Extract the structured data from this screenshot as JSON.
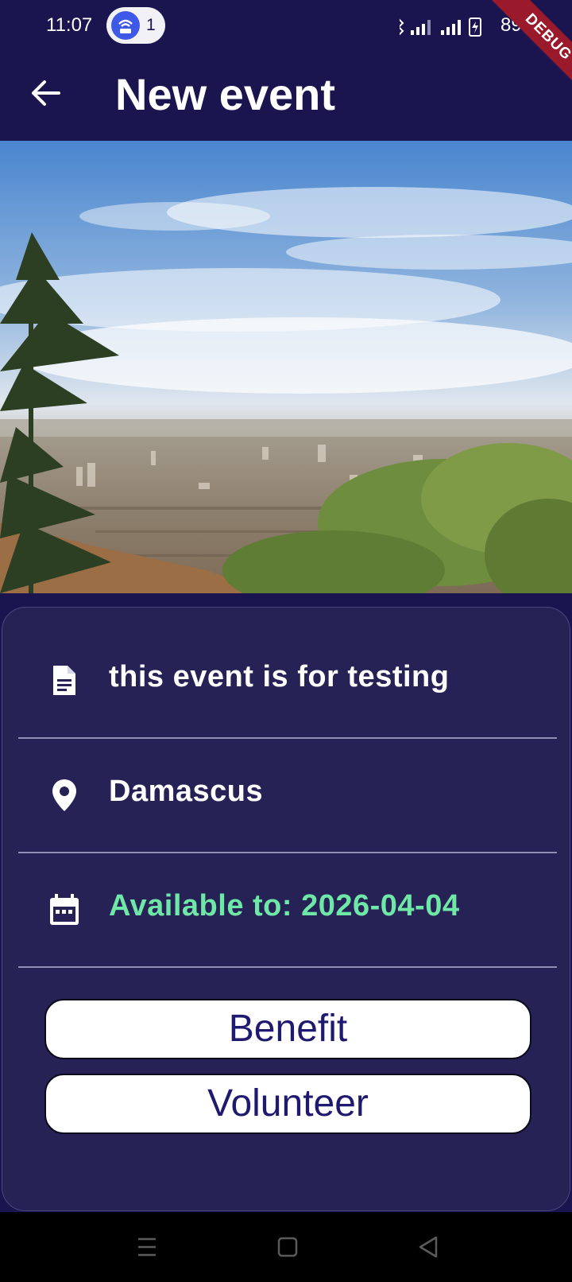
{
  "status_bar": {
    "time": "11:07",
    "hotspot_count": "1",
    "battery": "89%",
    "debug_label": "DEBUG",
    "icons": [
      "bluetooth-icon",
      "signal-icon",
      "signal-icon",
      "battery-charging-icon"
    ]
  },
  "app_bar": {
    "title": "New event",
    "back_icon": "arrow-back-icon"
  },
  "event": {
    "image_icon": "city-landscape-photo",
    "description": "this event is for testing",
    "location": "Damascus",
    "available_to": "Available to: 2026-04-04"
  },
  "actions": {
    "benefit_label": "Benefit",
    "volunteer_label": "Volunteer"
  },
  "nav_bar": {
    "icons": [
      "menu-icon",
      "home-icon",
      "back-icon"
    ]
  },
  "colors": {
    "background": "#1b154f",
    "card": "#262256",
    "accent_green": "#6ee7a7",
    "button_text": "#1f1a70",
    "debug_ribbon": "#9a1a2c"
  }
}
